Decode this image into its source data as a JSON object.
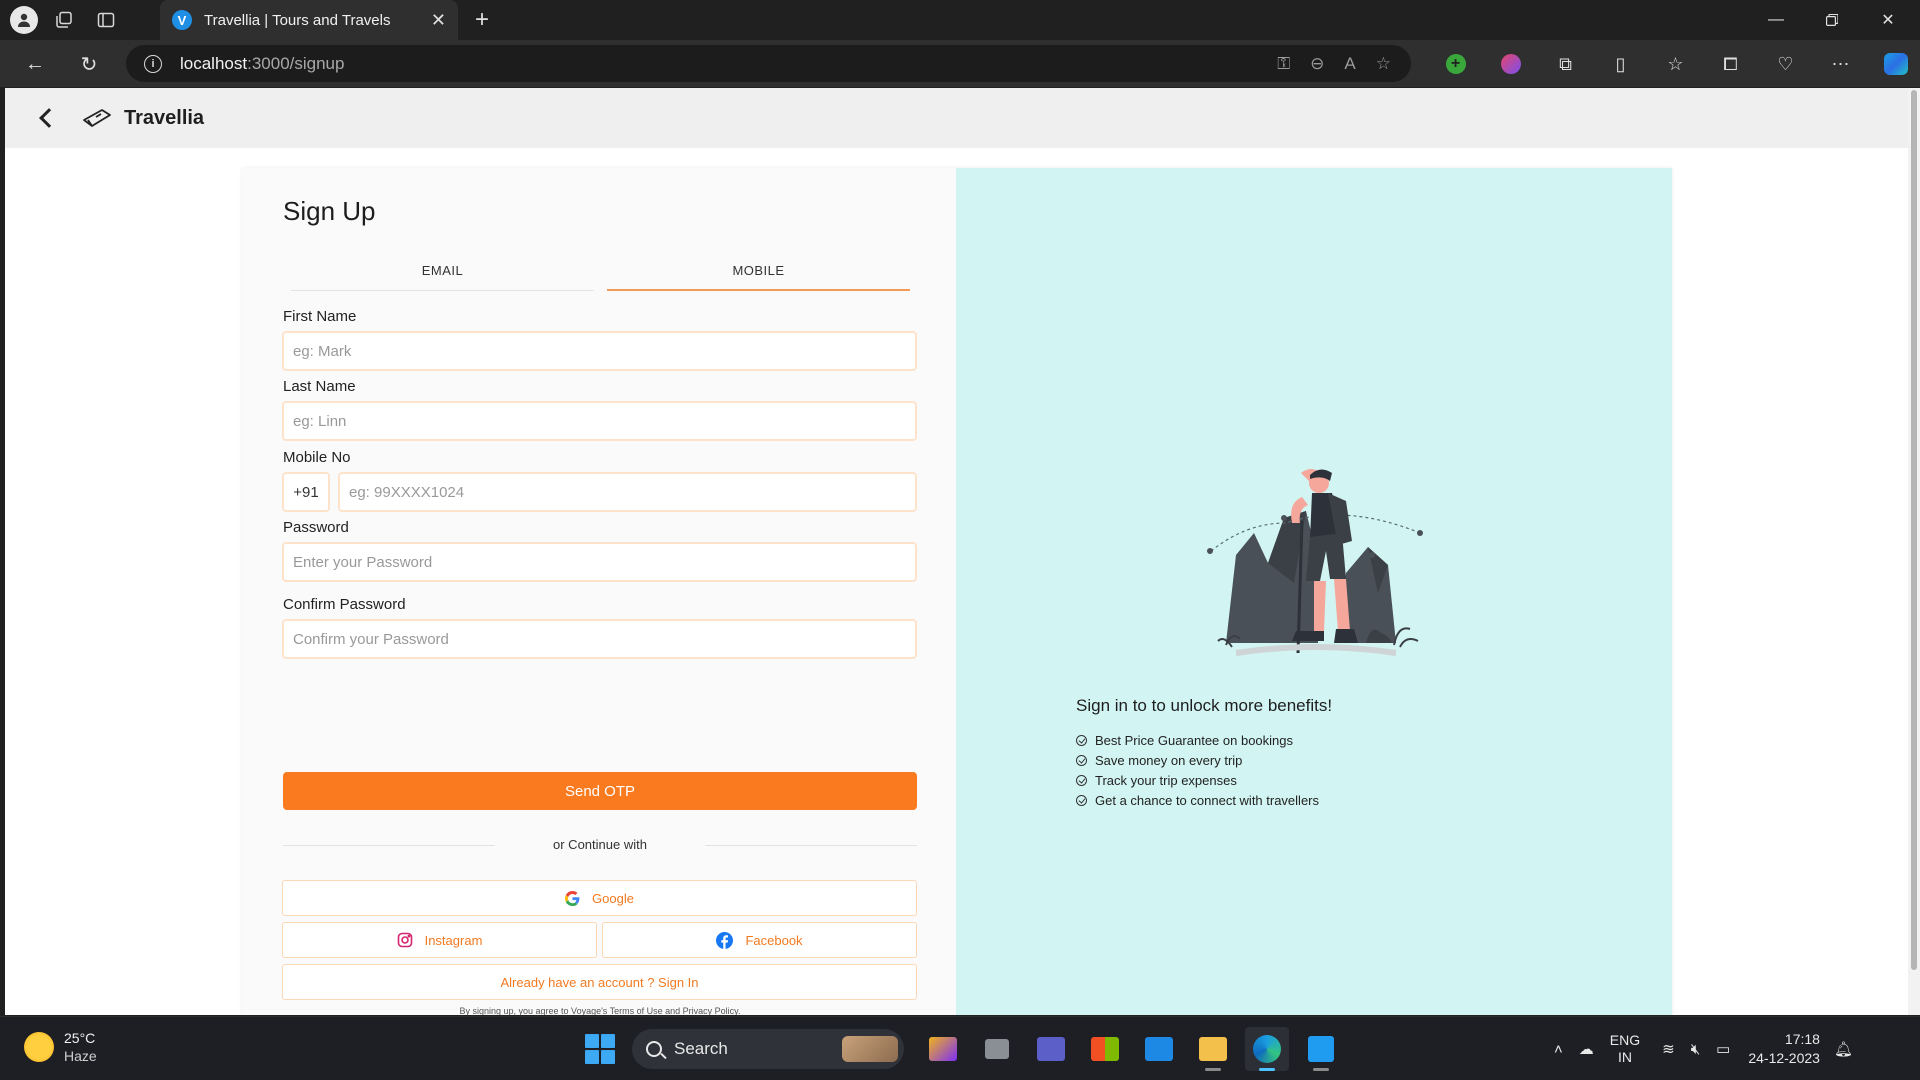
{
  "browser": {
    "tab_title": "Travellia | Tours and Travels",
    "tab_favicon_letter": "V",
    "url_host": "localhost",
    "url_path": ":3000/signup"
  },
  "app": {
    "brand": "Travellia"
  },
  "signup": {
    "title": "Sign Up",
    "tabs": [
      {
        "label": "EMAIL",
        "active": false
      },
      {
        "label": "MOBILE",
        "active": true
      }
    ],
    "fields": {
      "first_name": {
        "label": "First Name",
        "placeholder": "eg: Mark"
      },
      "last_name": {
        "label": "Last Name",
        "placeholder": "eg: Linn"
      },
      "mobile": {
        "label": "Mobile No",
        "country_code": "+91",
        "placeholder": "eg: 99XXXX1024"
      },
      "password": {
        "label": "Password",
        "placeholder": "Enter your Password"
      },
      "confirm_password": {
        "label": "Confirm Password",
        "placeholder": "Confirm your Password"
      }
    },
    "submit_label": "Send OTP",
    "divider_text": "or Continue with",
    "social": {
      "google": "Google",
      "instagram": "Instagram",
      "facebook": "Facebook"
    },
    "signin_link": "Already have an account ? Sign In",
    "fine_print": "By signing up, you agree to Voyage's Terms of Use and Privacy Policy."
  },
  "benefits": {
    "title": "Sign in to to unlock more benefits!",
    "items": [
      "Best Price Guarantee on bookings",
      "Save money on every trip",
      "Track your trip expenses",
      "Get a chance to connect with travellers"
    ]
  },
  "taskbar": {
    "weather_temp": "25°C",
    "weather_desc": "Haze",
    "search_label": "Search",
    "lang_top": "ENG",
    "lang_bottom": "IN",
    "time": "17:18",
    "date": "24-12-2023"
  },
  "colors": {
    "accent": "#f97a1f",
    "right_panel": "#d2f5f3",
    "input_border": "#fde3cc"
  }
}
